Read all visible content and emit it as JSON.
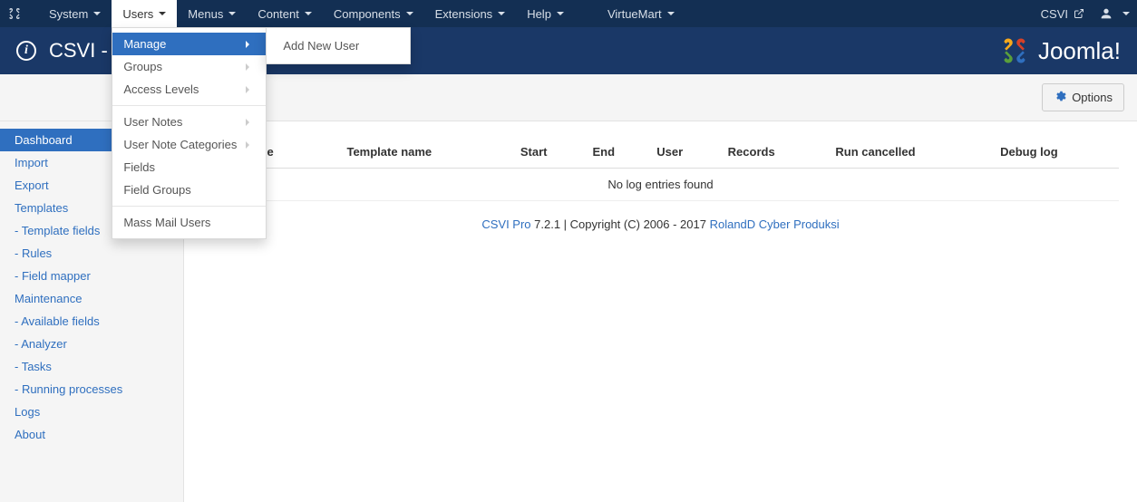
{
  "topnav": {
    "items": [
      {
        "label": "System"
      },
      {
        "label": "Users"
      },
      {
        "label": "Menus"
      },
      {
        "label": "Content"
      },
      {
        "label": "Components"
      },
      {
        "label": "Extensions"
      },
      {
        "label": "Help"
      },
      {
        "label": "VirtueMart"
      }
    ],
    "right_label": "CSVI"
  },
  "users_menu": {
    "items": [
      {
        "label": "Manage",
        "has_sub": true,
        "active": true
      },
      {
        "label": "Groups",
        "has_sub": true
      },
      {
        "label": "Access Levels",
        "has_sub": true
      },
      {
        "divider": true
      },
      {
        "label": "User Notes",
        "has_sub": true
      },
      {
        "label": "User Note Categories",
        "has_sub": true
      },
      {
        "label": "Fields"
      },
      {
        "label": "Field Groups"
      },
      {
        "divider": true
      },
      {
        "label": "Mass Mail Users"
      }
    ],
    "manage_sub": {
      "label": "Add New User"
    }
  },
  "titlebar": {
    "title": "CSVI - D",
    "brand": "Joomla!"
  },
  "toolbar": {
    "options_label": "Options"
  },
  "sidebar": {
    "items": [
      "Dashboard",
      "Import",
      "Export",
      "Templates",
      "- Template fields",
      "- Rules",
      "- Field mapper",
      "Maintenance",
      "- Available fields",
      "- Analyzer",
      "- Tasks",
      "- Running processes",
      "Logs",
      "About"
    ],
    "active_index": 0
  },
  "table": {
    "cols": [
      "Action type",
      "Template name",
      "Start",
      "End",
      "User",
      "Records",
      "Run cancelled",
      "Debug log"
    ],
    "empty_text": "No log entries found"
  },
  "footer": {
    "product": "CSVI Pro",
    "version_text": " 7.2.1 | Copyright (C) 2006 - 2017 ",
    "vendor": "RolandD Cyber Produksi"
  }
}
